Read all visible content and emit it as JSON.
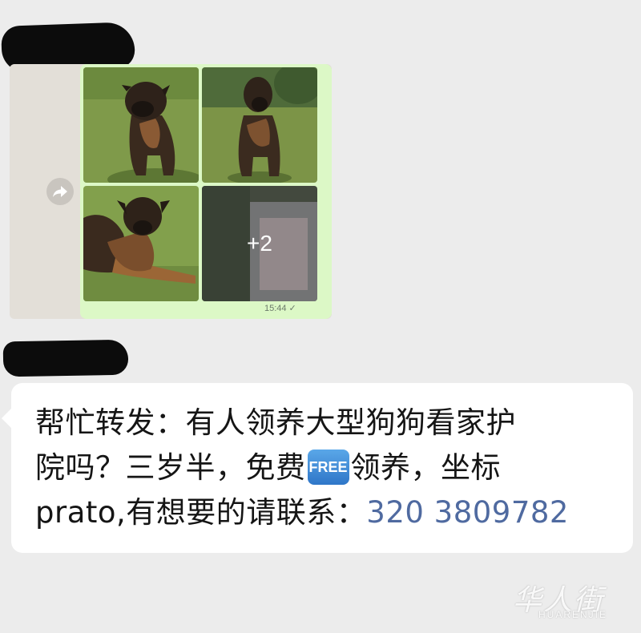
{
  "image_message": {
    "timestamp": "15:44",
    "more_photos_count": "+2",
    "photos": [
      "dog-photo",
      "dog-photo",
      "dog-photo",
      "blurred-photo"
    ]
  },
  "text_message": {
    "line1": "帮忙转发：有人领养大型狗狗看家护",
    "line2_a": "院吗？三岁半，免费",
    "free_badge": "FREE",
    "line2_b": "领养，坐标",
    "line3_a": "prato,有想要的请联系：",
    "phone": "320 3809782"
  },
  "watermark": {
    "cn": "华人街",
    "en": "HUARENJIE"
  },
  "icons": [
    "forward-icon",
    "check-icon"
  ],
  "colors": {
    "page_bg": "#ececec",
    "outgoing_bubble": "#dcf8c6",
    "incoming_bubble": "#ffffff",
    "phone_link": "#4f6aa0",
    "free_badge": "#3d8ad8"
  }
}
